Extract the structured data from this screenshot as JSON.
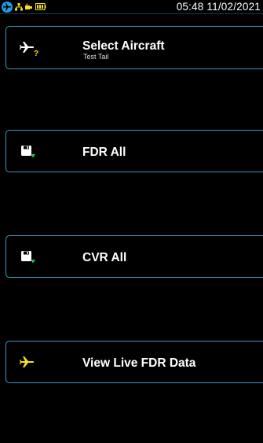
{
  "status_bar": {
    "datetime": "05:48 11/02/2021",
    "icons": [
      "aircraft-badge-icon",
      "network-icon",
      "usb-icon",
      "battery-icon"
    ]
  },
  "menu": {
    "items": [
      {
        "label": "Select Aircraft",
        "sublabel": "Test Tail",
        "icon": "aircraft-question-icon"
      },
      {
        "label": "FDR All",
        "sublabel": "",
        "icon": "save-download-icon"
      },
      {
        "label": "CVR All",
        "sublabel": "",
        "icon": "save-download-icon"
      },
      {
        "label": "View Live FDR Data",
        "sublabel": "",
        "icon": "aircraft-live-icon"
      }
    ]
  },
  "colors": {
    "background": "#000000",
    "button_border": "#3b95c0",
    "accent_yellow": "#f5e31a",
    "accent_green": "#22c55e",
    "badge_blue": "#1fa1e8"
  }
}
